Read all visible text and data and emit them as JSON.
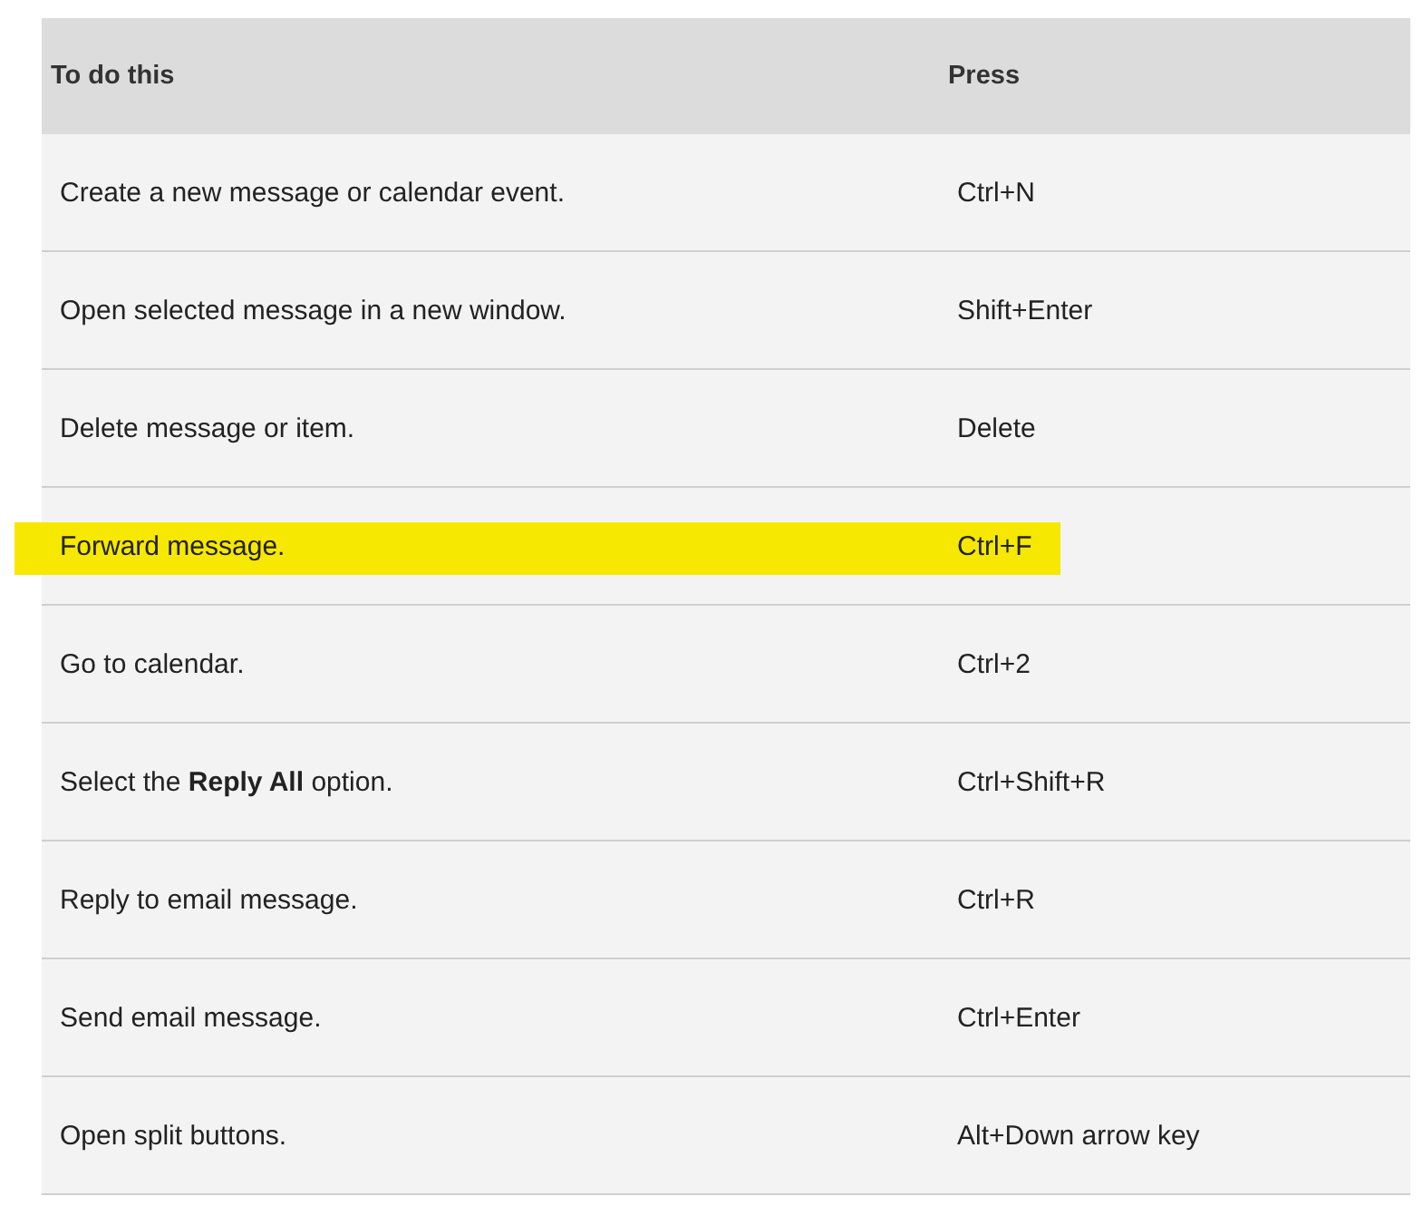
{
  "table": {
    "columns": [
      "To do this",
      "Press"
    ],
    "rows": [
      {
        "action": "Create a new message or calendar event.",
        "keys": "Ctrl+N",
        "highlighted": false
      },
      {
        "action": "Open selected message in a new window.",
        "keys": "Shift+Enter",
        "highlighted": false
      },
      {
        "action": "Delete message or item.",
        "keys": "Delete",
        "highlighted": false
      },
      {
        "action": "Forward message.",
        "keys": "Ctrl+F",
        "highlighted": true
      },
      {
        "action": "Go to calendar.",
        "keys": "Ctrl+2",
        "highlighted": false
      },
      {
        "action": "Select the **Reply All** option.",
        "keys": "Ctrl+Shift+R",
        "highlighted": false
      },
      {
        "action": "Reply to email message.",
        "keys": "Ctrl+R",
        "highlighted": false
      },
      {
        "action": "Send email message.",
        "keys": "Ctrl+Enter",
        "highlighted": false
      },
      {
        "action": "Open split buttons.",
        "keys": "Alt+Down arrow key",
        "highlighted": false
      }
    ]
  }
}
